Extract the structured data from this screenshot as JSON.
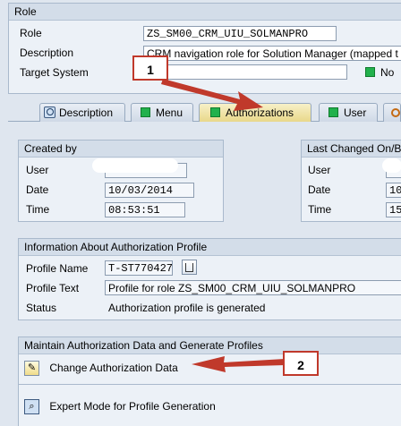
{
  "role_box": {
    "header": "Role",
    "role_label": "Role",
    "role_value": "ZS_SM00_CRM_UIU_SOLMANPRO",
    "description_label": "Description",
    "description_value": "CRM navigation role for Solution Manager (mapped t",
    "target_label": "Target System",
    "no_label": "No"
  },
  "tabs": [
    {
      "label": "Description"
    },
    {
      "label": "Menu"
    },
    {
      "label": "Authorizations"
    },
    {
      "label": "User"
    }
  ],
  "created_by": {
    "header": "Created by",
    "user_label": "User",
    "date_label": "Date",
    "date_value": "10/03/2014",
    "time_label": "Time",
    "time_value": "08:53:51"
  },
  "last_changed": {
    "header": "Last Changed On/B",
    "user_label": "User",
    "date_label": "Date",
    "date_value": "10",
    "time_label": "Time",
    "time_value": "15"
  },
  "auth_profile": {
    "header": "Information About Authorization Profile",
    "profile_name_label": "Profile Name",
    "profile_name_value": "T-ST770427",
    "profile_text_label": "Profile Text",
    "profile_text_value": "Profile for role ZS_SM00_CRM_UIU_SOLMANPRO",
    "status_label": "Status",
    "status_value": "Authorization profile is generated"
  },
  "maintain": {
    "header": "Maintain Authorization Data and Generate Profiles",
    "change_label": "Change Authorization Data",
    "expert_label": "Expert Mode for Profile Generation"
  },
  "callouts": {
    "one": "1",
    "two": "2"
  },
  "colors": {
    "arrow": "#c0392b",
    "active_tab": "#e9d88a",
    "status_green": "#22b14c"
  }
}
